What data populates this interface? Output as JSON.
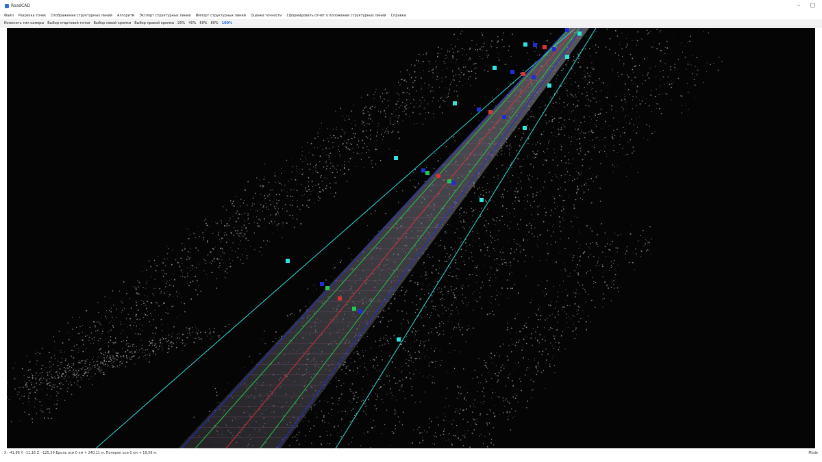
{
  "window": {
    "title": "RoadCAD",
    "controls": {
      "minimize": "–",
      "restore": "◻"
    }
  },
  "menu": [
    "Файл",
    "Разрезка точек",
    "Отображение структурных линий",
    "Алгоритм",
    "Экспорт структурных линий",
    "Импорт структурных линий",
    "Оценка точности",
    "Сформировать отчёт о положении структурных линий",
    "Справка"
  ],
  "toolbar": [
    {
      "label": "Изменить тип камеры",
      "active": false
    },
    {
      "label": "Выбор стартовой точки",
      "active": false
    },
    {
      "label": "Выбор левой кромки",
      "active": false
    },
    {
      "label": "Выбор правой кромки",
      "active": false
    },
    {
      "label": "20%",
      "active": false
    },
    {
      "label": "40%",
      "active": false
    },
    {
      "label": "60%",
      "active": false
    },
    {
      "label": "80%",
      "active": false
    },
    {
      "label": "100%",
      "active": true
    }
  ],
  "status": {
    "coords": "X: -41,86 Y: -11,16 Z: -125,59   Вдоль оси 0 км + 240,11 м. Поперек оси 0 км + 19,58 м.",
    "mode": "Mode"
  },
  "colors": {
    "viewport_bg": "#050505",
    "cloud": "#dcdcdc",
    "cyan_line": "#2ee6e0",
    "blue_line": "#1f2fd8",
    "green_line": "#22c84a",
    "red_line": "#d8343a",
    "accent": "#1a66d8"
  }
}
